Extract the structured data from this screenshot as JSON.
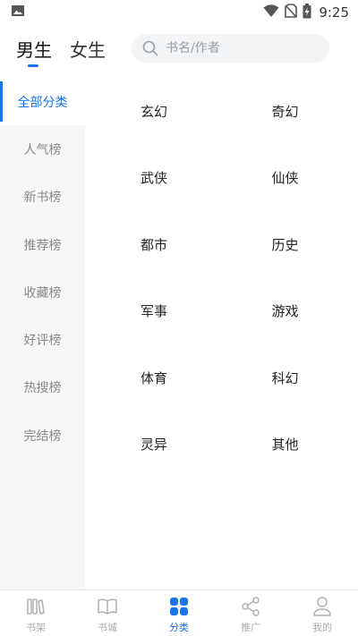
{
  "status_bar": {
    "time": "9:25",
    "icons": [
      "image-icon",
      "wifi-icon",
      "no-sim-icon",
      "battery-charging-icon"
    ]
  },
  "header": {
    "tabs": [
      {
        "label": "男生",
        "active": true
      },
      {
        "label": "女生",
        "active": false
      }
    ],
    "search": {
      "placeholder": "书名/作者",
      "value": ""
    }
  },
  "sidebar": {
    "items": [
      {
        "label": "全部分类",
        "active": true
      },
      {
        "label": "人气榜",
        "active": false
      },
      {
        "label": "新书榜",
        "active": false
      },
      {
        "label": "推荐榜",
        "active": false
      },
      {
        "label": "收藏榜",
        "active": false
      },
      {
        "label": "好评榜",
        "active": false
      },
      {
        "label": "热搜榜",
        "active": false
      },
      {
        "label": "完结榜",
        "active": false
      }
    ]
  },
  "categories": [
    "玄幻",
    "奇幻",
    "武侠",
    "仙侠",
    "都市",
    "历史",
    "军事",
    "游戏",
    "体育",
    "科幻",
    "灵异",
    "其他"
  ],
  "bottom_nav": {
    "items": [
      {
        "label": "书架",
        "icon": "bookshelf-icon",
        "active": false
      },
      {
        "label": "书城",
        "icon": "open-book-icon",
        "active": false
      },
      {
        "label": "分类",
        "icon": "category-grid-icon",
        "active": true
      },
      {
        "label": "推广",
        "icon": "share-icon",
        "active": false
      },
      {
        "label": "我的",
        "icon": "user-icon",
        "active": false
      }
    ]
  },
  "colors": {
    "accent": "#1a73e8",
    "sidebar_bg": "#f7f7f7",
    "inactive_text": "#888888",
    "search_bg": "#f3f4f6"
  }
}
